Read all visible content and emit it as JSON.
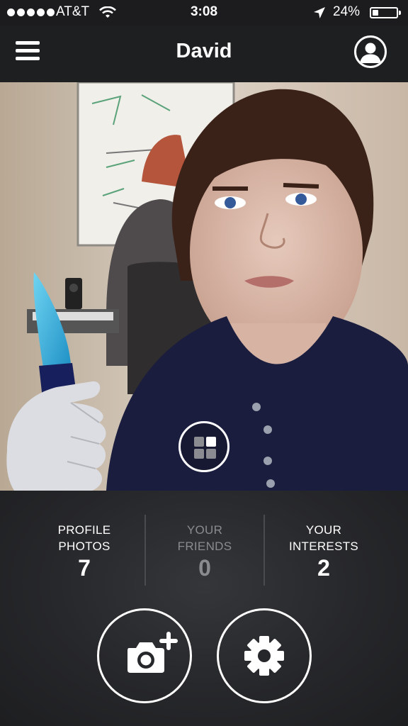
{
  "status_bar": {
    "carrier": "AT&T",
    "time": "3:08",
    "battery_text": "24%",
    "battery_level": 0.24,
    "signal_icon": "signal-dots-icon",
    "wifi_icon": "wifi-icon",
    "location_icon": "location-arrow-icon"
  },
  "header": {
    "title": "David",
    "menu_icon": "hamburger-menu-icon",
    "profile_icon": "user-profile-icon"
  },
  "photo": {
    "subject": "profile-photo",
    "gallery_icon": "grid-icon"
  },
  "stats": [
    {
      "line1": "PROFILE",
      "line2": "PHOTOS",
      "value": "7"
    },
    {
      "line1": "YOUR",
      "line2": "FRIENDS",
      "value": "0"
    },
    {
      "line1": "YOUR",
      "line2": "INTERESTS",
      "value": "2"
    }
  ],
  "actions": {
    "add_photo_icon": "camera-plus-icon",
    "settings_icon": "gear-icon"
  },
  "colors": {
    "background": "#1e1f21",
    "dim_text": "#8a8b8e",
    "accent": "#ffffff"
  }
}
